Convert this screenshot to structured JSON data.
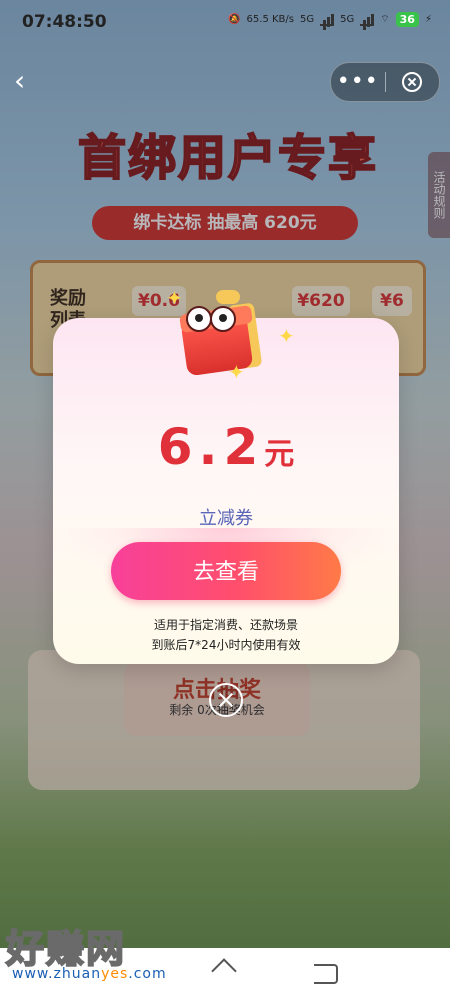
{
  "status_bar": {
    "time": "07:48:50",
    "net_speed": "65.5 KB/s",
    "net_type_1": "5G",
    "net_type_2": "5G",
    "battery": "36"
  },
  "background": {
    "hero_title": "首绑用户专享",
    "subtitle": "绑卡达标 抽最高 620元",
    "rules_tab": "活动规则",
    "reward_label": "奖励列表",
    "reward_chips": [
      "¥0.6",
      "¥620",
      "¥6"
    ],
    "draw_title": "点击抽奖",
    "draw_remaining": "剩余 0次抽奖机会"
  },
  "modal": {
    "amount": "6.2",
    "unit": "元",
    "coupon_type": "立减券",
    "cta_label": "去查看",
    "note_line1": "适用于指定消费、还款场景",
    "note_line2": "到账后7*24小时内使用有效"
  },
  "watermark": {
    "brand": "好赚网",
    "url_pre": "www.zhuan",
    "url_hl": "yes",
    "url_post": ".com"
  }
}
